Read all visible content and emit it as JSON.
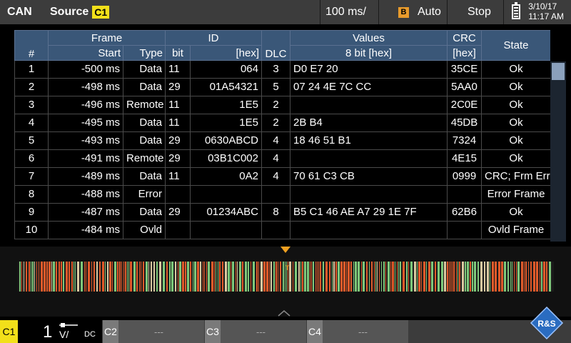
{
  "header": {
    "protocol": "CAN",
    "source_label": "Source",
    "source_channel": "C1",
    "timebase": "100 ms/",
    "trigger_badge": "B",
    "trigger_mode": "Auto",
    "run_state": "Stop",
    "date": "3/10/17",
    "time": "11:17 AM"
  },
  "table": {
    "headers": {
      "num": "#",
      "frame_group": "Frame",
      "frame_start": "Start",
      "frame_type": "Type",
      "id_group": "ID",
      "id_bit": "bit",
      "id_hex": "[hex]",
      "dlc": "DLC",
      "values_group": "Values",
      "values_sub": "8 bit [hex]",
      "crc_group": "CRC",
      "crc_sub": "[hex]",
      "state": "State"
    },
    "rows": [
      {
        "num": "1",
        "start": "-500 ms",
        "type": "Data",
        "bit": "11",
        "hex": "064",
        "dlc": "3",
        "values": "D0 E7 20",
        "crc": "35CE",
        "state": "Ok"
      },
      {
        "num": "2",
        "start": "-498 ms",
        "type": "Data",
        "bit": "29",
        "hex": "01A54321",
        "dlc": "5",
        "values": "07 24 4E 7C CC",
        "crc": "5AA0",
        "state": "Ok"
      },
      {
        "num": "3",
        "start": "-496 ms",
        "type": "Remote",
        "bit": "11",
        "hex": "1E5",
        "dlc": "2",
        "values": "",
        "crc": "2C0E",
        "state": "Ok"
      },
      {
        "num": "4",
        "start": "-495 ms",
        "type": "Data",
        "bit": "11",
        "hex": "1E5",
        "dlc": "2",
        "values": "2B B4",
        "crc": "45DB",
        "state": "Ok"
      },
      {
        "num": "5",
        "start": "-493 ms",
        "type": "Data",
        "bit": "29",
        "hex": "0630ABCD",
        "dlc": "4",
        "values": "18 46 51 B1",
        "crc": "7324",
        "state": "Ok"
      },
      {
        "num": "6",
        "start": "-491 ms",
        "type": "Remote",
        "bit": "29",
        "hex": "03B1C002",
        "dlc": "4",
        "values": "",
        "crc": "4E15",
        "state": "Ok"
      },
      {
        "num": "7",
        "start": "-489 ms",
        "type": "Data",
        "bit": "11",
        "hex": "0A2",
        "dlc": "4",
        "values": "70 61 C3 CB",
        "crc": "0999",
        "state": "CRC; Frm Error"
      },
      {
        "num": "8",
        "start": "-488 ms",
        "type": "Error",
        "bit": "",
        "hex": "",
        "dlc": "",
        "values": "",
        "crc": "",
        "state": "Error Frame"
      },
      {
        "num": "9",
        "start": "-487 ms",
        "type": "Data",
        "bit": "29",
        "hex": "01234ABC",
        "dlc": "8",
        "values": "B5 C1 46 AE A7 29 1E 7F",
        "crc": "62B6",
        "state": "Ok"
      },
      {
        "num": "10",
        "start": "-484 ms",
        "type": "Ovld",
        "bit": "",
        "hex": "",
        "dlc": "",
        "values": "",
        "crc": "",
        "state": "Ovld Frame"
      }
    ]
  },
  "waveform": {
    "trigger_marker": "T",
    "colors": [
      "#e05a2a",
      "#7dc87a",
      "#d9c9a0"
    ]
  },
  "channels": {
    "c1": {
      "label": "C1",
      "scale": "1",
      "unit": "V/",
      "coupling": "DC"
    },
    "c2": {
      "label": "C2",
      "value": "---"
    },
    "c3": {
      "label": "C3",
      "value": "---"
    },
    "c4": {
      "label": "C4",
      "value": "---"
    }
  },
  "logo": {
    "text": "R&S"
  },
  "colors": {
    "accent": "#f2e01a",
    "header_bg": "#3a5778",
    "bar_bg": "#3c3c3c",
    "trigger": "#f0a020"
  }
}
